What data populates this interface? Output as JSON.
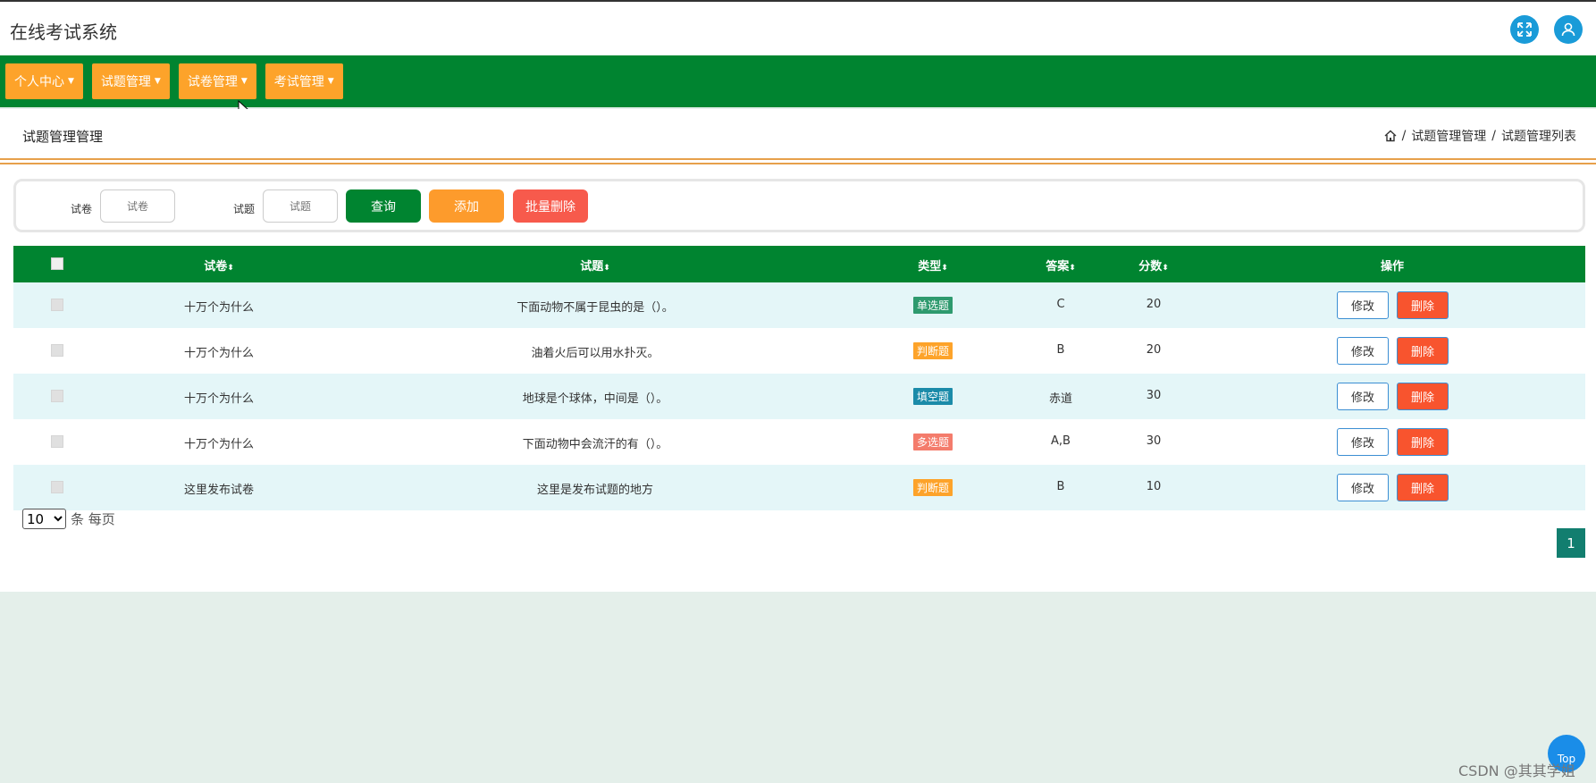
{
  "app": {
    "title": "在线考试系统"
  },
  "nav": {
    "items": [
      {
        "label": "个人中心"
      },
      {
        "label": "试题管理"
      },
      {
        "label": "试卷管理"
      },
      {
        "label": "考试管理"
      }
    ]
  },
  "page": {
    "title": "试题管理管理",
    "breadcrumb": [
      "试题管理管理",
      "试题管理列表"
    ],
    "separator": "/"
  },
  "search": {
    "paper_label": "试卷",
    "paper_placeholder": "试卷",
    "question_label": "试题",
    "question_placeholder": "试题",
    "query_button": "查询",
    "add_button": "添加",
    "batch_delete_button": "批量删除"
  },
  "table": {
    "headers": [
      "试卷",
      "试题",
      "类型",
      "答案",
      "分数",
      "操作"
    ],
    "sort_glyph": "⬍",
    "rows": [
      {
        "paper": "十万个为什么",
        "question": "下面动物不属于昆虫的是（）。",
        "type": "单选题",
        "type_color": "#2e9a6e",
        "answer": "C",
        "score": "20",
        "edit": "修改",
        "delete": "删除"
      },
      {
        "paper": "十万个为什么",
        "question": "油着火后可以用水扑灭。",
        "type": "判断题",
        "type_color": "#fda32a",
        "answer": "B",
        "score": "20",
        "edit": "修改",
        "delete": "删除"
      },
      {
        "paper": "十万个为什么",
        "question": "地球是个球体，中间是（）。",
        "type": "填空题",
        "type_color": "#1b8ba9",
        "answer": "赤道",
        "score": "30",
        "edit": "修改",
        "delete": "删除"
      },
      {
        "paper": "十万个为什么",
        "question": "下面动物中会流汗的有（）。",
        "type": "多选题",
        "type_color": "#f47c6c",
        "answer": "A,B",
        "score": "30",
        "edit": "修改",
        "delete": "删除"
      },
      {
        "paper": "这里发布试卷",
        "question": "这里是发布试题的地方",
        "type": "判断题",
        "type_color": "#fda32a",
        "answer": "B",
        "score": "10",
        "edit": "修改",
        "delete": "删除"
      }
    ]
  },
  "pagination": {
    "page_size": "10",
    "page_size_suffix": "条 每页",
    "current_page": "1"
  },
  "footer": {
    "top_button": "Top",
    "watermark": "CSDN @其其学姐"
  },
  "colors": {
    "primary_green": "#008430",
    "accent_orange": "#fda32a",
    "danger_red": "#f8542e",
    "row_alt": "#e4f6f8"
  }
}
